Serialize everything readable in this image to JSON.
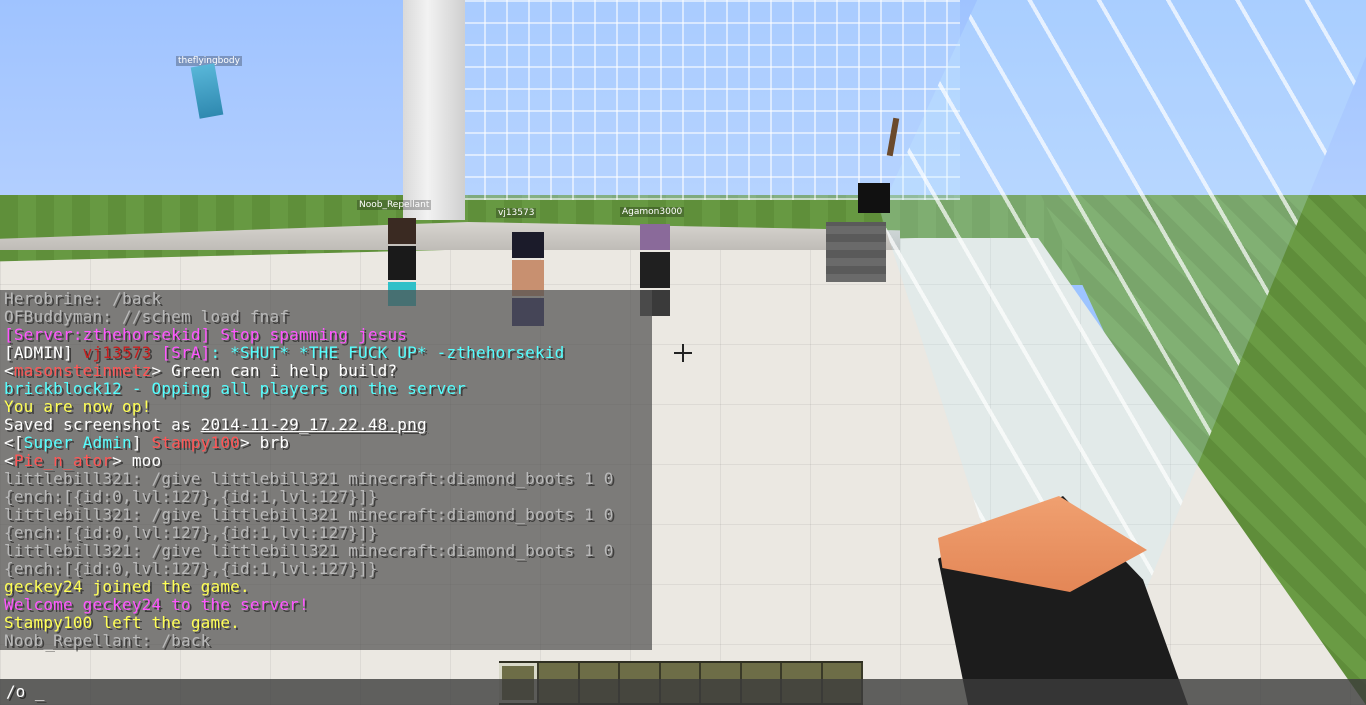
{
  "scene": {
    "nametags": {
      "drone": "theflyingbody",
      "player1": "Noob_Repellant",
      "player2": "vj13573",
      "player3": "Agamon3000"
    }
  },
  "chat": {
    "lines": [
      [
        {
          "t": "Herobrine: /back",
          "c": "gray"
        }
      ],
      [
        {
          "t": "OFBuddyman: //schem load fnaf",
          "c": "gray"
        }
      ],
      [
        {
          "t": "[Server:zthehorsekid] Stop spamming jesus",
          "c": "magenta"
        }
      ],
      [
        {
          "t": "[ADMIN] ",
          "c": "white"
        },
        {
          "t": "vj13573 ",
          "c": "darkred"
        },
        {
          "t": "[SrA]",
          "c": "magenta"
        },
        {
          "t": ": *SHUT* *THE FUCK UP* -zthehorsekid",
          "c": "aqua"
        }
      ],
      [
        {
          "t": "<",
          "c": "white"
        },
        {
          "t": "masonsteinmetz",
          "c": "red"
        },
        {
          "t": "> Green can i help build?",
          "c": "white"
        }
      ],
      [
        {
          "t": "brickblock12 - Opping all players on the server",
          "c": "aqua"
        }
      ],
      [
        {
          "t": "You are now op!",
          "c": "yellow"
        }
      ],
      [
        {
          "t": "Saved screenshot as ",
          "c": "white"
        },
        {
          "t": "2014-11-29_17.22.48.png",
          "c": "white",
          "u": true
        }
      ],
      [
        {
          "t": "<[",
          "c": "white"
        },
        {
          "t": "Super Admin",
          "c": "aqua"
        },
        {
          "t": "] ",
          "c": "white"
        },
        {
          "t": "Stampy100",
          "c": "red"
        },
        {
          "t": "> brb",
          "c": "white"
        }
      ],
      [
        {
          "t": "<",
          "c": "white"
        },
        {
          "t": "Pie_n_ator",
          "c": "red"
        },
        {
          "t": "> moo",
          "c": "white"
        }
      ],
      [
        {
          "t": "littlebill321: /give littlebill321 minecraft:diamond_boots 1 0",
          "c": "gray"
        }
      ],
      [
        {
          "t": " {ench:[{id:0,lvl:127},{id:1,lvl:127}]}",
          "c": "gray"
        }
      ],
      [
        {
          "t": "littlebill321: /give littlebill321 minecraft:diamond_boots 1 0",
          "c": "gray"
        }
      ],
      [
        {
          "t": " {ench:[{id:0,lvl:127},{id:1,lvl:127}]}",
          "c": "gray"
        }
      ],
      [
        {
          "t": "littlebill321: /give littlebill321 minecraft:diamond_boots 1 0",
          "c": "gray"
        }
      ],
      [
        {
          "t": " {ench:[{id:0,lvl:127},{id:1,lvl:127}]}",
          "c": "gray"
        }
      ],
      [
        {
          "t": "geckey24 joined the game.",
          "c": "yellow"
        }
      ],
      [
        {
          "t": "Welcome geckey24 to the server!",
          "c": "magenta"
        }
      ],
      [
        {
          "t": "Stampy100 left the game.",
          "c": "yellow"
        }
      ],
      [
        {
          "t": "Noob_Repellant: /back",
          "c": "gray"
        }
      ]
    ]
  },
  "input": {
    "value": "/o _"
  },
  "hotbar": {
    "slot_count": 9,
    "selected_index": 0
  },
  "colors": {
    "gray": "#b9b9b9",
    "white": "#ffffff",
    "magenta": "#ff55ff",
    "aqua": "#55ffff",
    "yellow": "#ffff55",
    "red": "#ff5555",
    "darkred": "#c81e1e"
  }
}
